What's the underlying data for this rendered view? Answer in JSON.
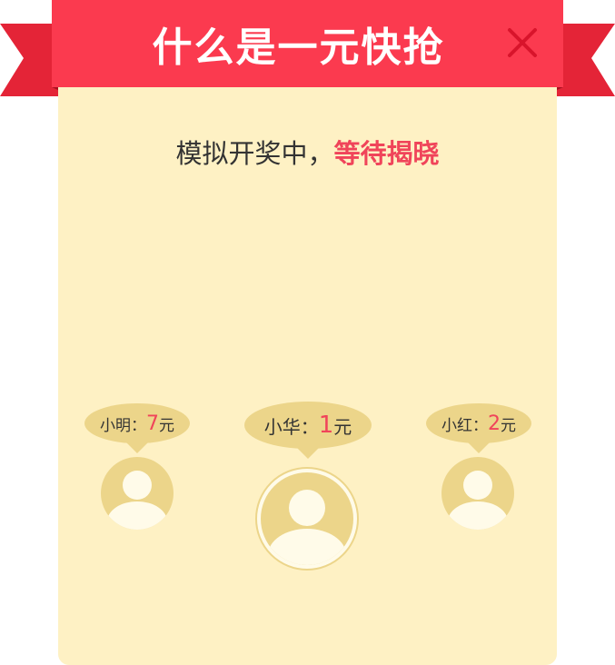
{
  "header": {
    "title": "什么是一元快抢"
  },
  "message": {
    "prefix": "模拟开奖中，",
    "highlight": "等待揭晓"
  },
  "players": [
    {
      "name": "小明：",
      "amount": "7",
      "unit": "元"
    },
    {
      "name": "小华：",
      "amount": "1",
      "unit": "元"
    },
    {
      "name": "小红：",
      "amount": "2",
      "unit": "元"
    }
  ],
  "colors": {
    "ribbon": "#fb3a4f",
    "card": "#fef1c4",
    "bubble": "#ecd58a",
    "highlight": "#f0445a"
  }
}
